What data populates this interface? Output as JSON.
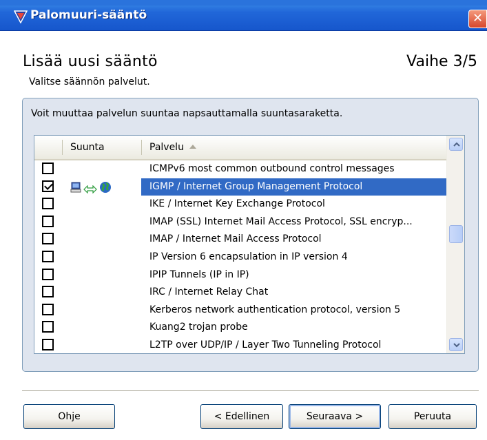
{
  "window": {
    "title": "Palomuuri-sääntö",
    "close_glyph": "✕"
  },
  "wizard": {
    "heading": "Lisää uusi sääntö",
    "step": "Vaihe 3/5",
    "subheading": "Valitse säännön palvelut.",
    "instruction": "Voit muuttaa palvelun suuntaa napsauttamalla suuntasaraketta."
  },
  "table": {
    "columns": {
      "direction": "Suunta",
      "service": "Palvelu"
    },
    "rows": [
      {
        "checked": false,
        "service": "ICMPv6 most common outbound control messages"
      },
      {
        "checked": true,
        "selected": true,
        "direction_icons": [
          "computer-icon",
          "bidirectional-arrow-icon",
          "globe-icon"
        ],
        "service": "IGMP / Internet Group Management Protocol"
      },
      {
        "checked": false,
        "service": "IKE / Internet Key Exchange Protocol"
      },
      {
        "checked": false,
        "service": "IMAP (SSL) Internet Mail Access Protocol, SSL encryp..."
      },
      {
        "checked": false,
        "service": "IMAP / Internet Mail Access Protocol"
      },
      {
        "checked": false,
        "service": "IP Version 6 encapsulation in IP version 4"
      },
      {
        "checked": false,
        "service": "IPIP Tunnels (IP in IP)"
      },
      {
        "checked": false,
        "service": "IRC / Internet Relay Chat"
      },
      {
        "checked": false,
        "service": "Kerberos network authentication protocol, version 5"
      },
      {
        "checked": false,
        "service": "Kuang2 trojan probe"
      },
      {
        "checked": false,
        "service": "L2TP over UDP/IP / Layer Two Tunneling Protocol"
      }
    ]
  },
  "buttons": {
    "help": "Ohje",
    "back": "< Edellinen",
    "next": "Seuraava >",
    "cancel": "Peruuta"
  },
  "colors": {
    "titlebar": "#2167d9",
    "selection": "#316ac5",
    "group_bg": "#dfe5ef"
  }
}
